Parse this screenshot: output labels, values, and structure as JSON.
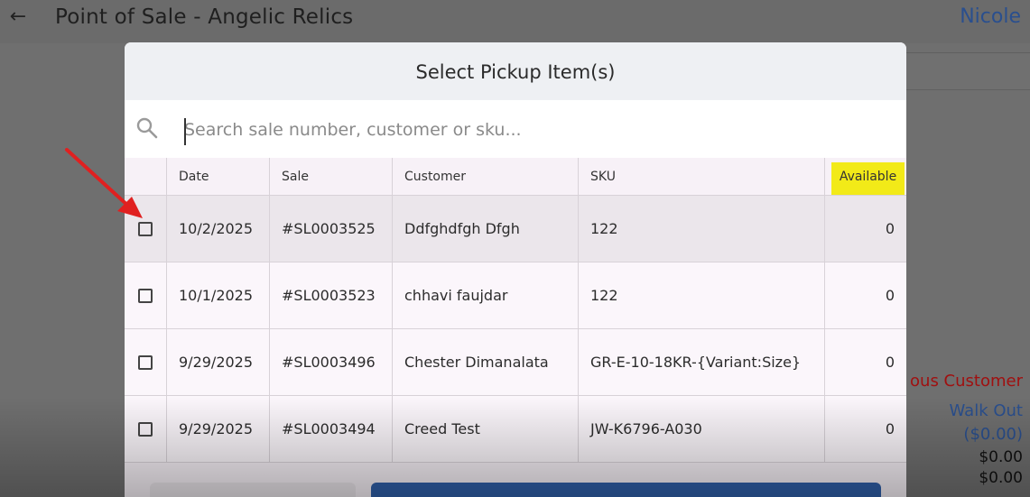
{
  "header": {
    "title": "Point of Sale - Angelic Relics",
    "user": "Nicole"
  },
  "background": {
    "customer_name": "ous Customer",
    "walk_out": "Walk Out",
    "balance": "($0.00)",
    "amount_1": "$0.00",
    "amount_2": "$0.00"
  },
  "modal": {
    "title": "Select Pickup Item(s)",
    "search": {
      "placeholder": "Search sale number, customer or sku...",
      "value": ""
    },
    "columns": [
      "Date",
      "Sale",
      "Customer",
      "SKU",
      "Available"
    ],
    "rows": [
      {
        "date": "10/2/2025",
        "sale": "#SL0003525",
        "customer": "Ddfghdfgh Dfgh",
        "sku": "122",
        "available": "0",
        "checked": false
      },
      {
        "date": "10/1/2025",
        "sale": "#SL0003523",
        "customer": "chhavi faujdar",
        "sku": "122",
        "available": "0",
        "checked": false
      },
      {
        "date": "9/29/2025",
        "sale": "#SL0003496",
        "customer": "Chester Dimanalata",
        "sku": "GR-E-10-18KR-{Variant:Size}",
        "available": "0",
        "checked": false
      },
      {
        "date": "9/29/2025",
        "sale": "#SL0003494",
        "customer": "Creed Test",
        "sku": "JW-K6796-A030",
        "available": "0",
        "checked": false
      }
    ]
  },
  "colors": {
    "accent_blue": "#2f5fa8",
    "highlight_yellow": "#f2ea18",
    "annotation_red": "#e02020"
  }
}
